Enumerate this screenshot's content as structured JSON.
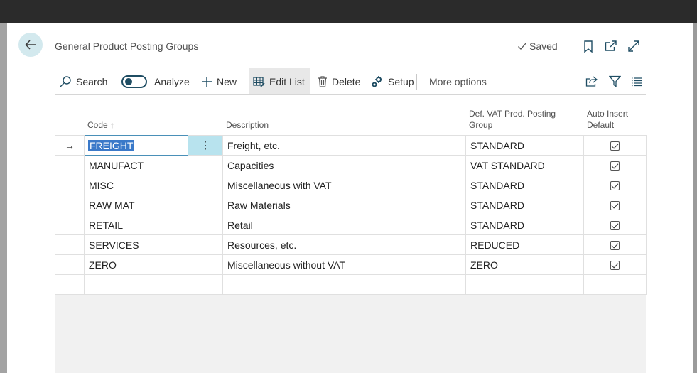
{
  "window": {
    "title": "General Product Posting Groups",
    "status": "Saved"
  },
  "actions": {
    "search": "Search",
    "analyze": "Analyze",
    "new": "New",
    "edit_list": "Edit List",
    "delete": "Delete",
    "setup": "Setup",
    "more_options": "More options"
  },
  "columns": {
    "code": "Code",
    "code_sort": "↑",
    "description": "Description",
    "vat_line1": "Def. VAT Prod. Posting",
    "vat_line2": "Group",
    "auto_line1": "Auto Insert",
    "auto_line2": "Default"
  },
  "rows": [
    {
      "code": "FREIGHT",
      "description": "Freight, etc.",
      "vat": "STANDARD",
      "auto_insert": true
    },
    {
      "code": "MANUFACT",
      "description": "Capacities",
      "vat": "VAT STANDARD",
      "auto_insert": true
    },
    {
      "code": "MISC",
      "description": "Miscellaneous with VAT",
      "vat": "STANDARD",
      "auto_insert": true
    },
    {
      "code": "RAW MAT",
      "description": "Raw Materials",
      "vat": "STANDARD",
      "auto_insert": true
    },
    {
      "code": "RETAIL",
      "description": "Retail",
      "vat": "STANDARD",
      "auto_insert": true
    },
    {
      "code": "SERVICES",
      "description": "Resources, etc.",
      "vat": "REDUCED",
      "auto_insert": true
    },
    {
      "code": "ZERO",
      "description": "Miscellaneous without VAT",
      "vat": "ZERO",
      "auto_insert": true
    }
  ],
  "selected_row_indicator": "→",
  "row_menu_glyph": "⋮",
  "colors": {
    "accent": "#1f4d63",
    "selection": "#3a79c9",
    "menu_cell": "#b8e3ee"
  }
}
